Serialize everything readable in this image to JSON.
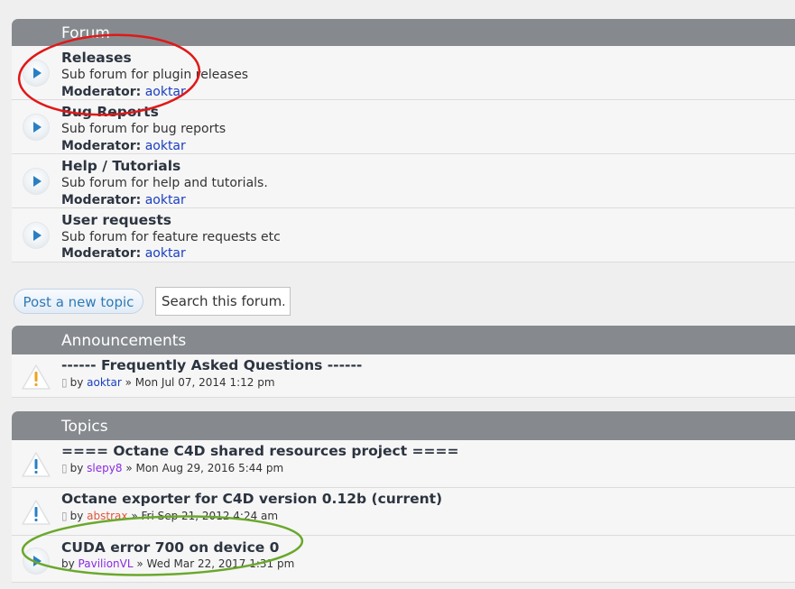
{
  "forum_section": {
    "header": "Forum",
    "forums": [
      {
        "title": "Releases",
        "description": "Sub forum for plugin releases",
        "moderator_label": "Moderator:",
        "moderator": "aoktar"
      },
      {
        "title": "Bug Reports",
        "description": "Sub forum for bug reports",
        "moderator_label": "Moderator:",
        "moderator": "aoktar"
      },
      {
        "title": "Help / Tutorials",
        "description": "Sub forum for help and tutorials.",
        "moderator_label": "Moderator:",
        "moderator": "aoktar"
      },
      {
        "title": "User requests",
        "description": "Sub forum for feature requests etc",
        "moderator_label": "Moderator:",
        "moderator": "aoktar"
      }
    ]
  },
  "actions": {
    "post_new_topic": "Post a new topic",
    "search_placeholder": "Search this forum.."
  },
  "announcements": {
    "header": "Announcements",
    "items": [
      {
        "title": "------ Frequently Asked Questions ------",
        "by": "by",
        "author": "aoktar",
        "sep": "»",
        "date": "Mon Jul 07, 2014 1:12 pm"
      }
    ]
  },
  "topics": {
    "header": "Topics",
    "items": [
      {
        "title": "==== Octane C4D shared resources project ====",
        "by": "by",
        "author": "slepy8",
        "sep": "»",
        "date": "Mon Aug 29, 2016 5:44 pm"
      },
      {
        "title": "Octane exporter for C4D version 0.12b (current)",
        "by": "by",
        "author": "abstrax",
        "sep": "»",
        "date": "Fri Sep 21, 2012 4:24 am"
      },
      {
        "title": "CUDA error 700 on device 0",
        "by": "by",
        "author": "PavilionVL",
        "sep": "»",
        "date": "Wed Mar 22, 2017 1:31 pm"
      }
    ]
  },
  "colors": {
    "header_bg": "#868a8e",
    "row_bg": "#f6f6f6",
    "link_blue": "#1a3fc0",
    "author_purple": "#8a2be2",
    "author_red": "#e0553b",
    "annotation_red": "#e01818",
    "annotation_green": "#6aa82c"
  },
  "icons": {
    "forum_read": "play-circle-icon",
    "announcement": "warning-triangle-icon",
    "sticky": "warning-triangle-blue-icon",
    "attachment": "paperclip-icon"
  }
}
